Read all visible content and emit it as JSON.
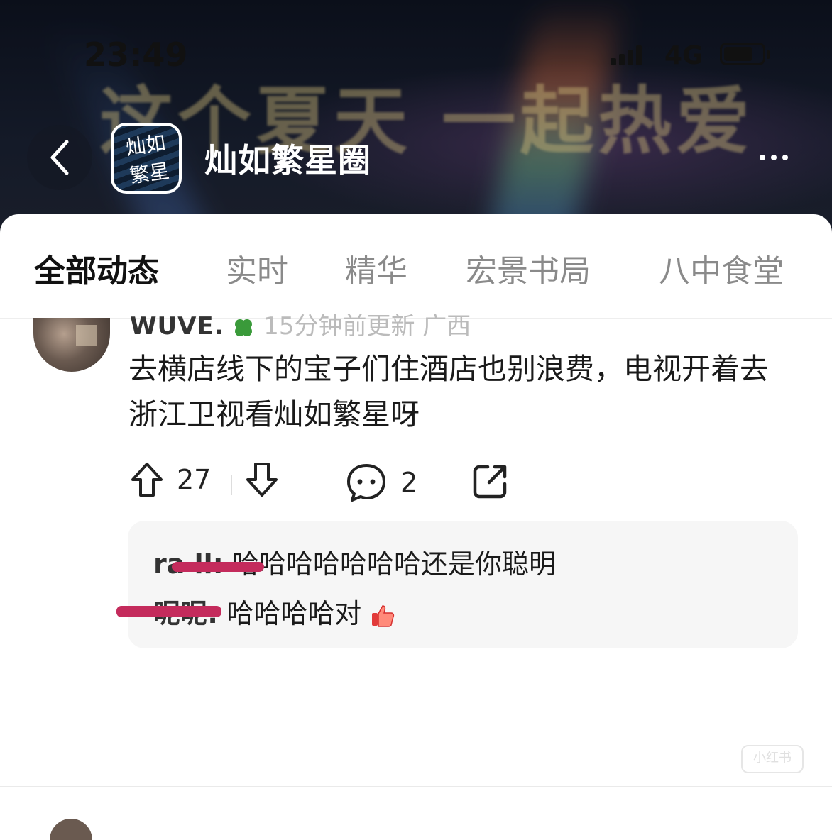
{
  "status_bar": {
    "time": "23:49",
    "network": "4G"
  },
  "header": {
    "banner_slogan": "这个夏天 一起热爱",
    "logo_text": "灿如繁星",
    "title": "灿如繁星圈"
  },
  "tabs": [
    {
      "label": "全部动态",
      "active": true
    },
    {
      "label": "实时",
      "active": false
    },
    {
      "label": "精华",
      "active": false
    },
    {
      "label": "宏景书局",
      "active": false
    },
    {
      "label": "八中食堂",
      "active": false
    }
  ],
  "post": {
    "username": "WUVE.",
    "meta": "15分钟前更新 广西",
    "text": "去横店线下的宝子们住酒店也别浪费，电视开着去浙江卫视看灿如繁星呀",
    "upvotes": "27",
    "comments": "2",
    "replies": [
      {
        "who": "ra  ll:",
        "text": "哈哈哈哈哈哈哈还是你聪明"
      },
      {
        "who": "呢呢:",
        "text": "哈哈哈哈对"
      }
    ]
  },
  "watermark": "小红书",
  "colors": {
    "censor": "#c42b5c",
    "header_bg": "#111826",
    "accent_text": "#111111"
  }
}
